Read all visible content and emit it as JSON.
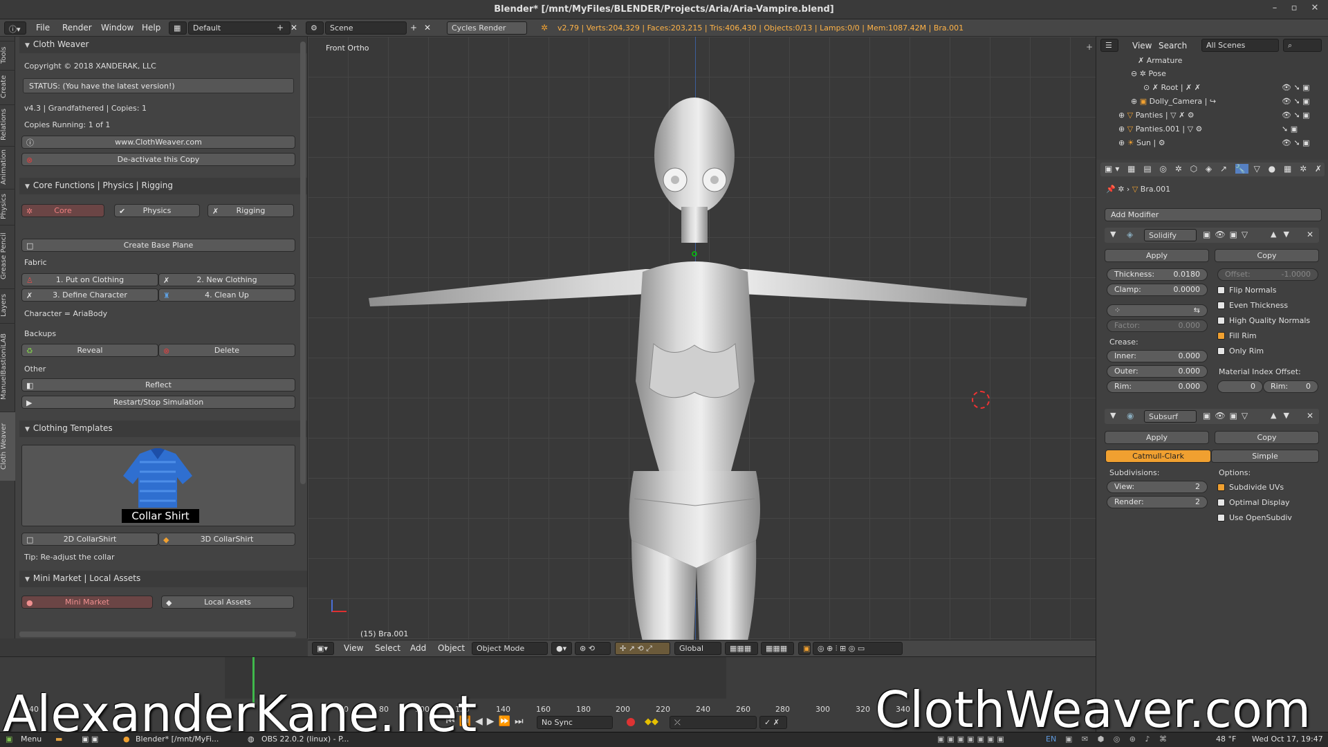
{
  "window": {
    "title": "Blender* [/mnt/MyFiles/BLENDER/Projects/Aria/Aria-Vampire.blend]",
    "minimize": "–",
    "restore": "▫",
    "close": "✕"
  },
  "infobar": {
    "menus": [
      "File",
      "Render",
      "Window",
      "Help"
    ],
    "layout": "Default",
    "scene": "Scene",
    "engine": "Cycles Render",
    "stats": "v2.79 | Verts:204,329 | Faces:203,215 | Tris:406,430 | Objects:0/13 | Lamps:0/0 | Mem:1087.42M | Bra.001"
  },
  "vtabs": [
    "Tools",
    "Create",
    "Relations",
    "Animation",
    "Physics",
    "Grease Pencil",
    "Layers",
    "ManuelBastioniLAB",
    "Cloth Weaver"
  ],
  "toolshelf": {
    "panel1": {
      "title": "Cloth Weaver",
      "copyright": "Copyright © 2018 XANDERAK, LLC",
      "status": "STATUS: (You have the latest version!)",
      "version": "v4.3 | Grandfathered | Copies: 1",
      "running": "Copies Running: 1 of 1",
      "website": "www.ClothWeaver.com",
      "deactivate": "De-activate this Copy"
    },
    "panel2": {
      "title": "Core Functions | Physics | Rigging",
      "tabs": [
        "Core",
        "Physics",
        "Rigging"
      ],
      "base_plane": "Create Base Plane",
      "fabric": "Fabric",
      "put_on": "1. Put on Clothing",
      "new_clothing": "2. New Clothing",
      "define": "3. Define Character",
      "cleanup": "4. Clean Up",
      "character": "Character = AriaBody",
      "backups": "Backups",
      "reveal": "Reveal",
      "delete": "Delete",
      "other": "Other",
      "reflect": "Reflect",
      "restart": "Restart/Stop Simulation"
    },
    "panel3": {
      "title": "Clothing Templates",
      "thumb_label": "Collar Shirt",
      "btn2d": "2D CollarShirt",
      "btn3d": "3D CollarShirt",
      "tip": "Tip: Re-adjust the collar"
    },
    "panel4": {
      "title": "Mini Market | Local Assets",
      "mini": "Mini Market",
      "local": "Local Assets"
    }
  },
  "viewport": {
    "label": "Front Ortho",
    "object": "(15) Bra.001"
  },
  "view_header": {
    "menus": [
      "View",
      "Select",
      "Add",
      "Object"
    ],
    "mode": "Object Mode",
    "orientation": "Global"
  },
  "timeline": {
    "ticks": [
      "40",
      "60",
      "80",
      "100",
      "120",
      "140",
      "160",
      "180",
      "200",
      "220",
      "240",
      "260",
      "280",
      "300",
      "320",
      "340"
    ],
    "sync": "No Sync"
  },
  "outliner": {
    "menus": [
      "View",
      "Search"
    ],
    "filter": "All Scenes",
    "items": [
      "Armature",
      "Pose",
      "Root",
      "Dolly_Camera",
      "Panties",
      "Panties.001",
      "Sun"
    ]
  },
  "properties": {
    "object": "Bra.001",
    "add_modifier": "Add Modifier",
    "solidify": {
      "name": "Solidify",
      "apply": "Apply",
      "copy": "Copy",
      "thickness_label": "Thickness:",
      "thickness": "0.0180",
      "offset_label": "Offset:",
      "offset": "-1.0000",
      "clamp_label": "Clamp:",
      "clamp": "0.0000",
      "factor_label": "Factor:",
      "factor": "0.000",
      "crease": "Crease:",
      "inner_label": "Inner:",
      "inner": "0.000",
      "outer_label": "Outer:",
      "outer": "0.000",
      "rim_label": "Rim:",
      "rim": "0.000",
      "flip": "Flip Normals",
      "even": "Even Thickness",
      "hq": "High Quality Normals",
      "fill": "Fill Rim",
      "only": "Only Rim",
      "mat_offset": "Material Index Offset:",
      "mat_val": "0",
      "mat_rim_label": "Rim:",
      "mat_rim": "0"
    },
    "subsurf": {
      "name": "Subsurf",
      "apply": "Apply",
      "copy": "Copy",
      "catmull": "Catmull-Clark",
      "simple": "Simple",
      "subdivisions": "Subdivisions:",
      "options": "Options:",
      "view_label": "View:",
      "view": "2",
      "render_label": "Render:",
      "render": "2",
      "uvs": "Subdivide UVs",
      "optimal": "Optimal Display",
      "opensubdiv": "Use OpenSubdiv"
    }
  },
  "watermarks": {
    "left": "AlexanderKane.net",
    "right": "ClothWeaver.com"
  },
  "taskbar": {
    "menu": "Menu",
    "blender": "Blender* [/mnt/MyFi...",
    "obs": "OBS 22.0.2 (linux) - P...",
    "lang": "EN",
    "weather": "48 °F",
    "clock": "Wed Oct 17, 19:47"
  },
  "colors": {
    "accent": "#f0a030",
    "selected": "#5680c2"
  }
}
